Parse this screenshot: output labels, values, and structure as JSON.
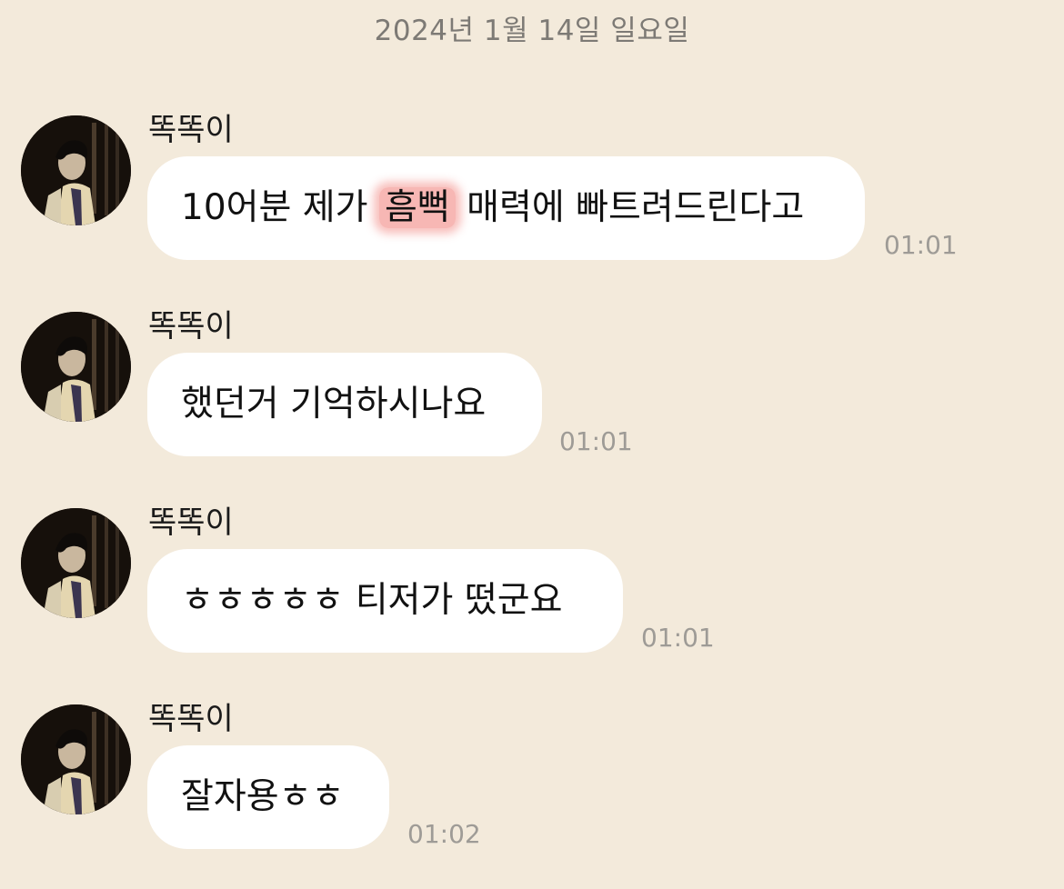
{
  "date_divider": "2024년 1월 14일 일요일",
  "messages": [
    {
      "sender": "똑똑이",
      "text_before": "10어분 제가 ",
      "highlighted": "흠뻑",
      "text_after": " 매력에 빠트려드린다고",
      "time": "01:01"
    },
    {
      "sender": "똑똑이",
      "text": "했던거 기억하시나요",
      "time": "01:01"
    },
    {
      "sender": "똑똑이",
      "text": "ㅎㅎㅎㅎㅎ 티저가 떴군요",
      "time": "01:01"
    },
    {
      "sender": "똑똑이",
      "text": "잘자용ㅎㅎ",
      "time": "01:02"
    }
  ],
  "colors": {
    "background": "#f3eadb",
    "bubble": "#ffffff",
    "timestamp": "#9e9b96",
    "highlight": "#f7b7b4"
  },
  "icons": {
    "avatar": "profile-photo"
  }
}
